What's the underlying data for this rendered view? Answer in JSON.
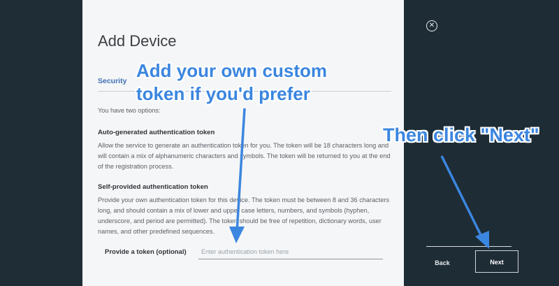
{
  "dialog": {
    "title": "Add Device",
    "section": "Security",
    "intro": "You have two options:",
    "auto": {
      "heading": "Auto-generated authentication token",
      "body": "Allow the service to generate an authentication token for you. The token will be 18 characters long and will contain a mix of alphanumeric characters and symbols. The token will be returned to you at the end of the registration process."
    },
    "self": {
      "heading": "Self-provided authentication token",
      "body": "Provide your own authentication token for this device. The token must be between 8 and 36 characters long, and should contain a mix of lower and upper case letters, numbers, and symbols (hyphen, underscore, and period are permitted). The token should be free of repetition, dictionary words, user names, and other predefined sequences."
    },
    "token_label": "Provide a token (optional)",
    "token_placeholder": "Enter authentication token here",
    "token_value": ""
  },
  "footer": {
    "back_label": "Back",
    "next_label": "Next",
    "close_icon": "close-icon"
  },
  "annotations": {
    "callout_token_line1": "Add your own custom",
    "callout_token_line2": "token if you'd prefer",
    "callout_next": "Then click \"Next\"",
    "color": "#3b86df"
  }
}
